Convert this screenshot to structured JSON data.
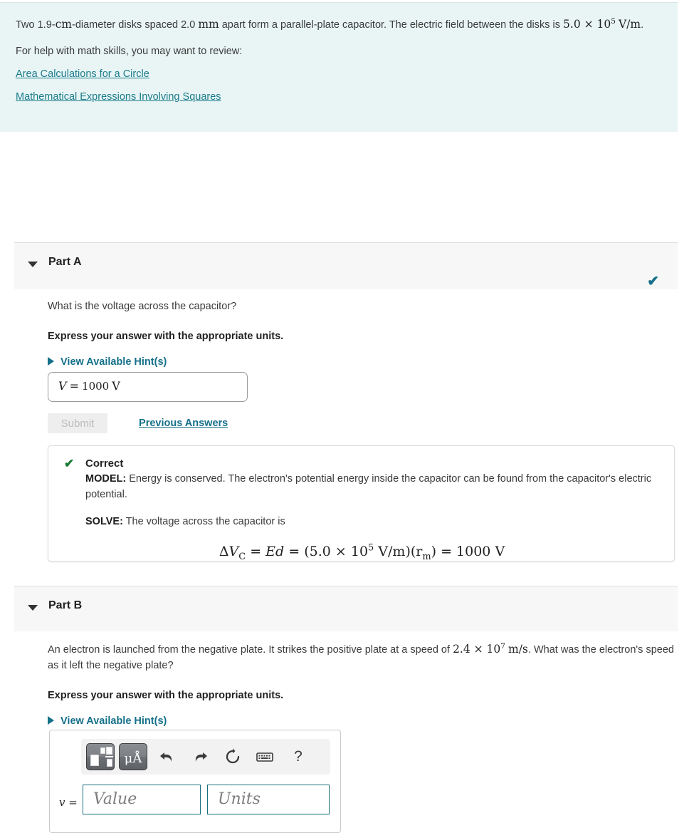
{
  "problem": {
    "statement_pre": "Two 1.9-",
    "statement_unit1": "cm",
    "statement_mid": "-diameter disks spaced 2.0 ",
    "statement_unit2": "mm",
    "statement_mid2": " apart form a parallel-plate capacitor. The electric field between the disks is ",
    "field_value": "5.0 × 10",
    "field_exp": "5",
    "field_units": "V/m",
    "statement_end": ".",
    "help_line": "For help with math skills, you may want to review:",
    "links": [
      "Area Calculations for a Circle",
      "Mathematical Expressions Involving Squares"
    ]
  },
  "part_a": {
    "title": "Part A",
    "caret_icon": "chevron-down-icon",
    "status_icon": "check-icon",
    "question": "What is the voltage across the capacitor?",
    "instruction": "Express your answer with the appropriate units.",
    "hints_label": "View Available Hint(s)",
    "answer": {
      "variable": "V",
      "equals": "=",
      "value": "1000",
      "units": "V"
    },
    "submit_label": "Submit",
    "previous_answers_label": "Previous Answers",
    "feedback": {
      "status": "Correct",
      "check_icon": "check-icon",
      "model_label": "MODEL:",
      "model_text": " Energy is conserved. The electron's potential energy inside the capacitor can be found from the capacitor's electric potential.",
      "solve_label": "SOLVE:",
      "solve_text": " The voltage across the capacitor is",
      "equation": {
        "lhs_delta": "Δ",
        "lhs_var": "V",
        "lhs_sub": "C",
        "eq1": " = ",
        "rhs1": "Ed",
        "eq2": " = (",
        "coef": "5.0 × 10",
        "coef_exp": "5",
        "coef_units": " V/m",
        "paren": ")(",
        "dist_var": "r",
        "dist_sub": "m",
        "paren2": ")",
        "eq3": " = ",
        "result": "1000 V"
      }
    }
  },
  "part_b": {
    "title": "Part B",
    "caret_icon": "chevron-down-icon",
    "question_pre": "An electron is launched from the negative plate. It strikes the positive plate at a speed of ",
    "speed_value": "2.4 × 10",
    "speed_exp": "7",
    "speed_units": "m/s",
    "question_post": ". What was the electron's speed as it left the negative plate?",
    "instruction": "Express your answer with the appropriate units.",
    "hints_label": "View Available Hint(s)",
    "toolbar": {
      "template_button": "template-icon",
      "units_button": "μÅ",
      "undo": "undo-icon",
      "redo": "redo-icon",
      "reset": "reset-icon",
      "keyboard": "keyboard-icon",
      "help": "?"
    },
    "answer": {
      "variable": "v =",
      "value_placeholder": "Value",
      "units_placeholder": "Units"
    }
  },
  "colors": {
    "panel_bg": "#e8f5f4",
    "accent_teal": "#15708a",
    "link_teal": "#1b7b8c",
    "correct_green": "#1a7a34",
    "part_header_bg": "#f7f7f7",
    "field_border": "#1b6e80"
  }
}
